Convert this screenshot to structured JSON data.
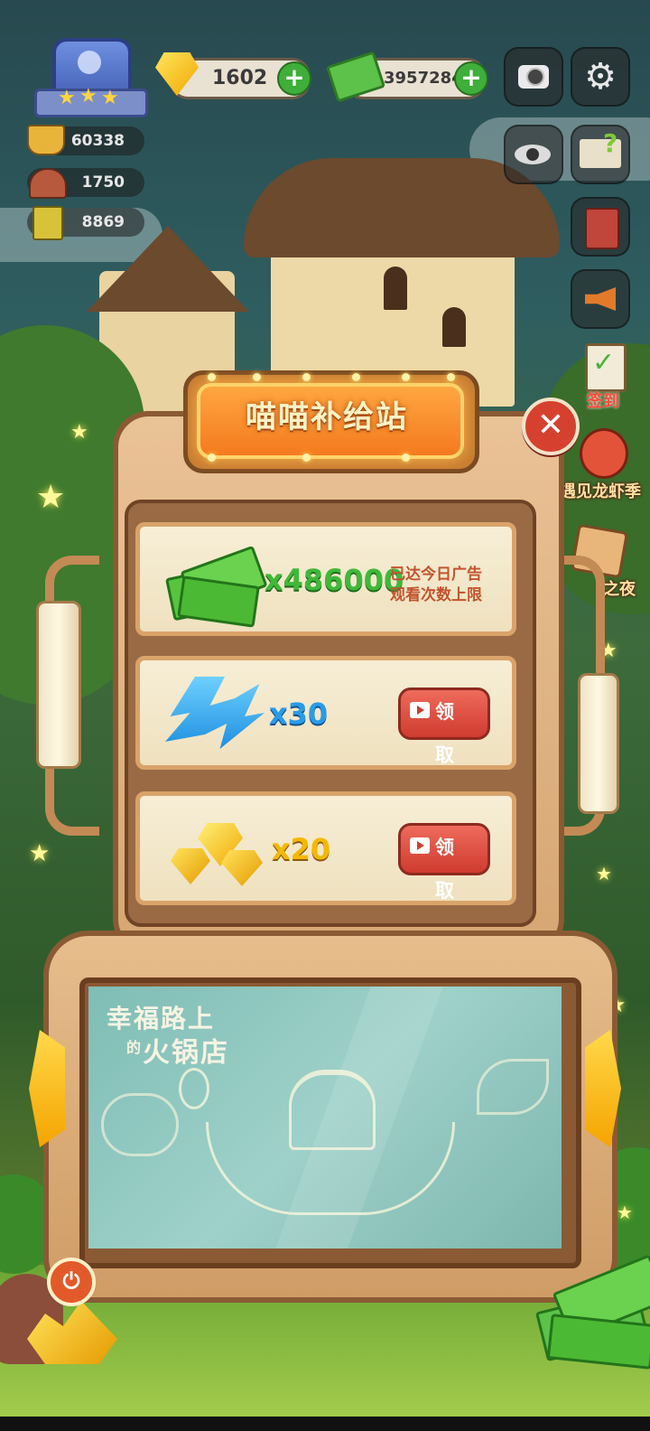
{
  "hud": {
    "gems": "1602",
    "cash": "3957284",
    "plus": "+",
    "stat_1": "60338",
    "stat_2": "1750",
    "stat_3": "8869"
  },
  "side_menu": {
    "checkin_label": "签到",
    "event_1_label": "遇见龙虾季",
    "event_2_label": "之夜"
  },
  "panel": {
    "title": "喵喵补给站",
    "close_glyph": "✕",
    "rewards": [
      {
        "icon": "cash-stack-icon",
        "amount": "x486000",
        "status": "已达今日广告\n观看次数上限",
        "status_line1": "已达今日广告",
        "status_line2": "观看次数上限"
      },
      {
        "icon": "lightning-icon",
        "amount": "x30",
        "button": "领 取"
      },
      {
        "icon": "gold-gem-pile-icon",
        "amount": "x20",
        "button": "领 取"
      }
    ],
    "screen_caption_line1": "幸福路上",
    "screen_caption_line2_small": "的",
    "screen_caption_line2": "火锅店"
  },
  "colors": {
    "accent_orange": "#f47a1e",
    "claim_red": "#cf3b2f",
    "cash_green": "#3fae3a",
    "energy_blue": "#2a9be8",
    "gem_gold": "#f5b800"
  }
}
